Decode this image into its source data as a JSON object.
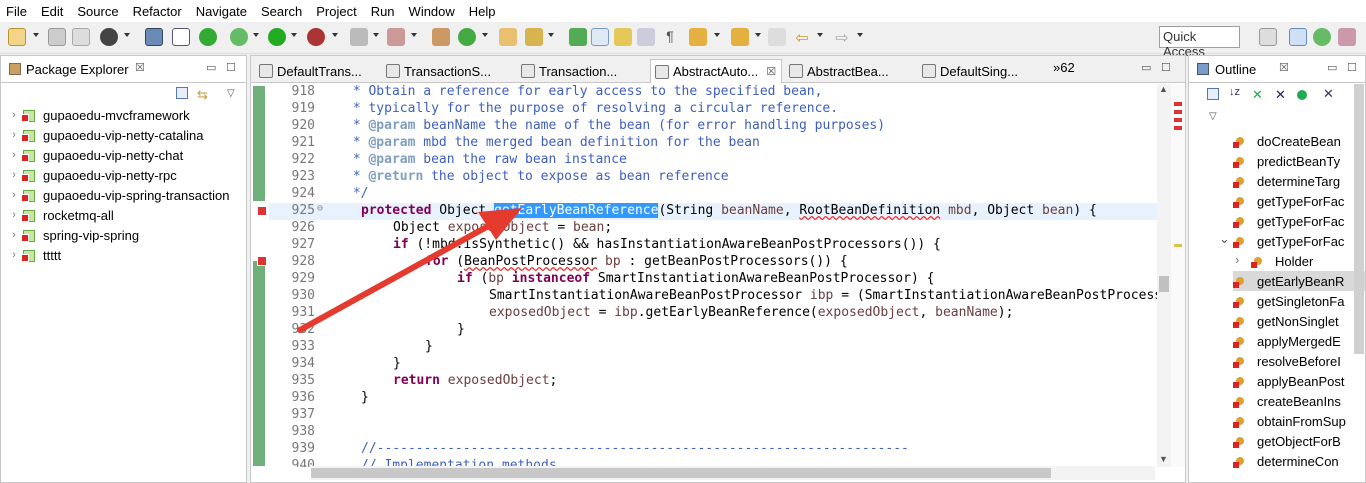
{
  "menu": [
    "File",
    "Edit",
    "Source",
    "Refactor",
    "Navigate",
    "Search",
    "Project",
    "Run",
    "Window",
    "Help"
  ],
  "quick_access": "Quick Access",
  "package_explorer": {
    "title": "Package Explorer",
    "projects": [
      "gupaoedu-mvcframework",
      "gupaoedu-vip-netty-catalina",
      "gupaoedu-vip-netty-chat",
      "gupaoedu-vip-netty-rpc",
      "gupaoedu-vip-spring-transaction",
      "rocketmq-all",
      "spring-vip-spring",
      "ttttt"
    ]
  },
  "editor": {
    "tabs": [
      "DefaultTrans...",
      "TransactionS...",
      "Transaction...",
      "AbstractAuto...",
      "AbstractBea...",
      "DefaultSing..."
    ],
    "overflow": "»62"
  },
  "outline": {
    "title": "Outline",
    "items": [
      "doCreateBean",
      "predictBeanTy",
      "determineTarg",
      "getTypeForFac",
      "getTypeForFac",
      "getTypeForFac",
      "Holder",
      "getEarlyBeanR",
      "getSingletonFa",
      "getNonSinglet",
      "applyMergedE",
      "resolveBeforeI",
      "applyBeanPost",
      "createBeanIns",
      "obtainFromSup",
      "getObjectForB",
      "determineCon"
    ]
  },
  "code": {
    "line_numbers": [
      "918",
      "919",
      "920",
      "921",
      "922",
      "923",
      "924",
      "925",
      "926",
      "927",
      "928",
      "929",
      "930",
      "931",
      "932",
      "933",
      "934",
      "935",
      "936",
      "937",
      "938",
      "939",
      "940"
    ],
    "l918": " * Obtain a reference for early access to the specified bean,",
    "l919": " * typically for the purpose of resolving a circular reference.",
    "l920_tag": "@param",
    "l920": " beanName the name of the bean (for error handling purposes)",
    "l921_tag": "@param",
    "l921": " mbd the merged bean definition for the bean",
    "l922_tag": "@param",
    "l922": " bean the raw bean instance",
    "l923_tag": "@return",
    "l923": " the object to expose as bean reference",
    "l924": " */",
    "l925_kw": "protected",
    "l925_a": " Object ",
    "l925_sel": "getEarlyBeanReference",
    "l925_b": "(String ",
    "l925_v1": "beanName",
    "l925_c": ", ",
    "l925_err": "RootBeanDefinition",
    "l925_d": " ",
    "l925_v2": "mbd",
    "l925_e": ", Object ",
    "l925_v3": "bean",
    "l925_f": ") {",
    "l926_a": "Object ",
    "l926_v": "exposedObject",
    "l926_b": " = ",
    "l926_v2": "bean",
    "l926_c": ";",
    "l927_kw": "if",
    "l927": " (!mbd.isSynthetic() && hasInstantiationAwareBeanPostProcessors()) {",
    "l928_kw": "for",
    "l928_a": " (",
    "l928_err": "BeanPostProcessor",
    "l928_b": " ",
    "l928_v": "bp",
    "l928_c": " : getBeanPostProcessors()) {",
    "l929_kw": "if",
    "l929_a": " (",
    "l929_v": "bp",
    "l929_kw2": " instanceof",
    "l929_b": " SmartInstantiationAwareBeanPostProcessor) {",
    "l930_a": "SmartInstantiationAwareBeanPostProcessor ",
    "l930_v": "ibp",
    "l930_b": " = (SmartInstantiationAwareBeanPostProcess",
    "l931_v": "exposedObject",
    "l931_a": " = ",
    "l931_v2": "ibp",
    "l931_b": ".getEarlyBeanReference(",
    "l931_v3": "exposedObject",
    "l931_c": ", ",
    "l931_v4": "beanName",
    "l931_d": ");",
    "l932": "}",
    "l933": "}",
    "l934": "}",
    "l935_kw": "return",
    "l935_v": " exposedObject",
    "l935": ";",
    "l936": "}",
    "l939": "//--------------------------------------------------------------------",
    "l940": "// Implementation methods"
  },
  "colors": {
    "selection": "#3399ff",
    "comment": "#3f5fbf",
    "keyword": "#7f0055",
    "arrow": "#e53a2e"
  }
}
